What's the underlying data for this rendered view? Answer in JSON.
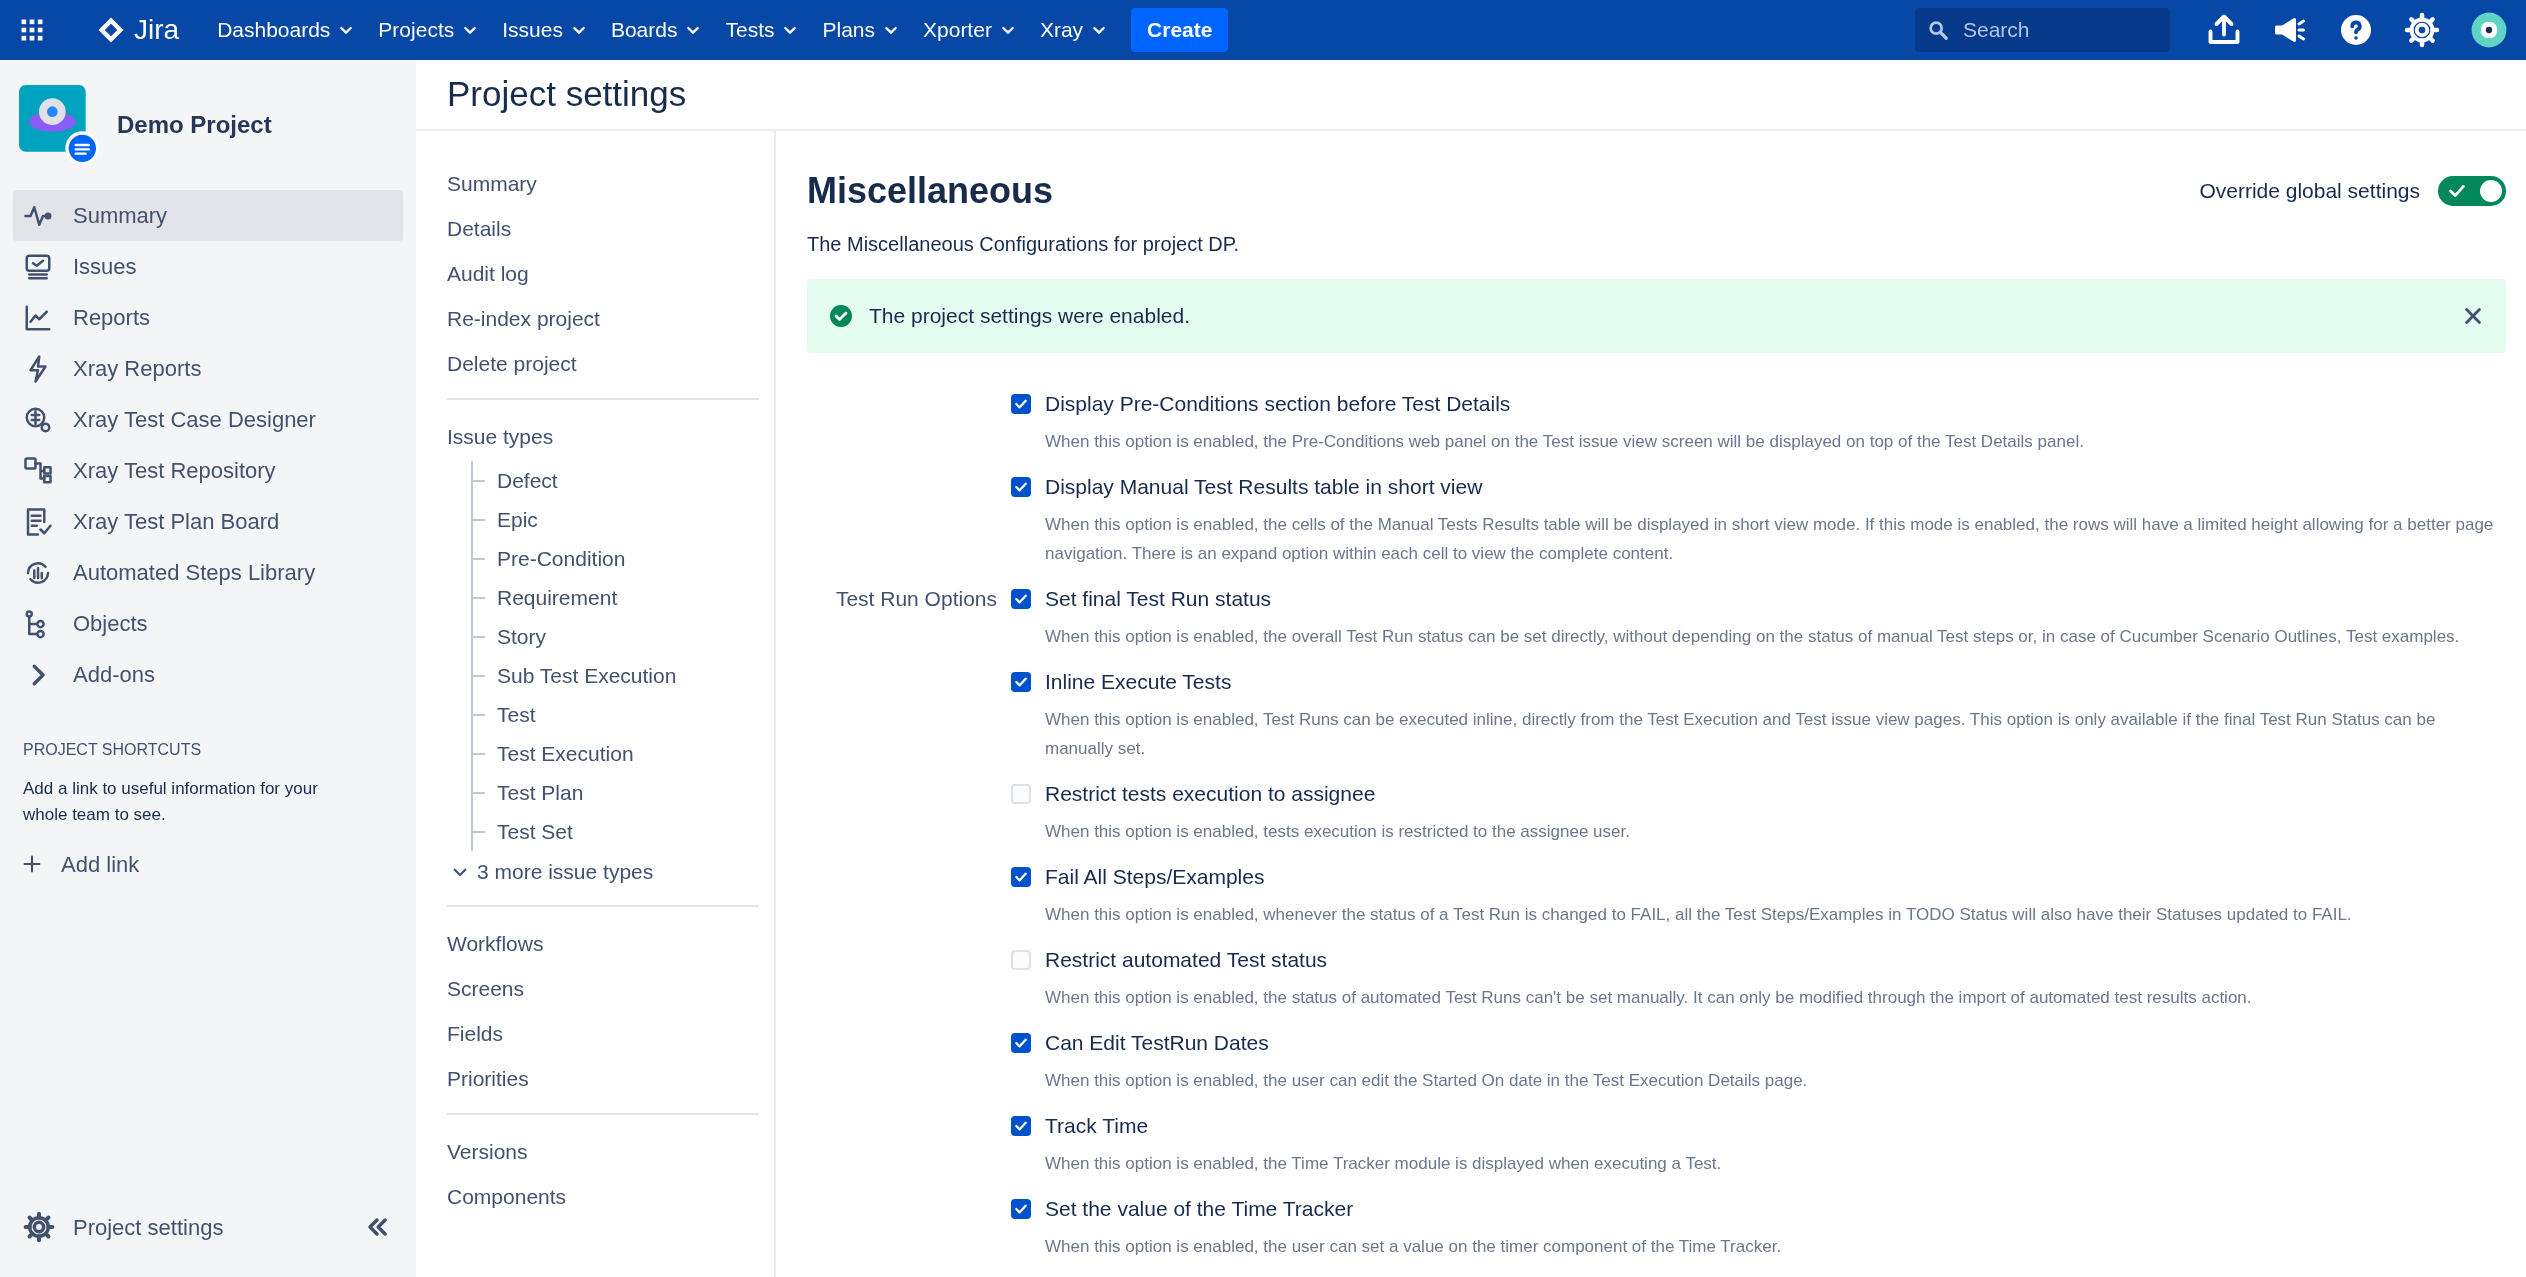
{
  "topbar": {
    "product": "Jira",
    "menus": [
      "Dashboards",
      "Projects",
      "Issues",
      "Boards",
      "Tests",
      "Plans",
      "Xporter",
      "Xray"
    ],
    "create": "Create",
    "search": {
      "placeholder": "Search"
    }
  },
  "sidebar": {
    "project": "Demo Project",
    "items": [
      {
        "label": "Summary",
        "selected": true
      },
      {
        "label": "Issues",
        "selected": false
      },
      {
        "label": "Reports",
        "selected": false
      },
      {
        "label": "Xray Reports",
        "selected": false
      },
      {
        "label": "Xray Test Case Designer",
        "selected": false
      },
      {
        "label": "Xray Test Repository",
        "selected": false
      },
      {
        "label": "Xray Test Plan Board",
        "selected": false
      },
      {
        "label": "Automated Steps Library",
        "selected": false
      },
      {
        "label": "Objects",
        "selected": false
      },
      {
        "label": "Add-ons",
        "selected": false
      }
    ],
    "shortcuts_heading": "PROJECT SHORTCUTS",
    "shortcuts_text": "Add a link to useful information for your whole team to see.",
    "add_link": "Add link",
    "footer": "Project settings"
  },
  "settings_nav": {
    "title": "Project settings",
    "sections": [
      {
        "items": [
          "Summary",
          "Details",
          "Audit log",
          "Re-index project",
          "Delete project"
        ]
      },
      {
        "heading": "Issue types",
        "children": [
          "Defect",
          "Epic",
          "Pre-Condition",
          "Requirement",
          "Story",
          "Sub Test Execution",
          "Test",
          "Test Execution",
          "Test Plan",
          "Test Set"
        ],
        "more": "3 more issue types"
      },
      {
        "items": [
          "Workflows",
          "Screens",
          "Fields",
          "Priorities"
        ]
      },
      {
        "items": [
          "Versions",
          "Components"
        ]
      }
    ]
  },
  "main": {
    "title": "Miscellaneous",
    "override": {
      "label": "Override global settings",
      "on": true
    },
    "subtitle": "The Miscellaneous Configurations for project DP.",
    "banner": "The project settings were enabled.",
    "groups": [
      {
        "options": [
          {
            "label": "Display Pre-Conditions section before Test Details",
            "checked": true,
            "description": "When this option is enabled, the Pre-Conditions web panel on the Test issue view screen will be displayed on top of the Test Details panel."
          },
          {
            "label": "Display Manual Test Results table in short view",
            "checked": true,
            "description": "When this option is enabled, the cells of the Manual Tests Results table will be displayed in short view mode. If this mode is enabled, the rows will have a limited height allowing for a better page navigation. There is an expand option within each cell to view the complete content."
          }
        ]
      },
      {
        "label": "Test Run Options",
        "options": [
          {
            "label": "Set final Test Run status",
            "checked": true,
            "description": "When this option is enabled, the overall Test Run status can be set directly, without depending on the status of manual Test steps or, in case of Cucumber Scenario Outlines, Test examples."
          },
          {
            "label": "Inline Execute Tests",
            "checked": true,
            "description": "When this option is enabled, Test Runs can be executed inline, directly from the Test Execution and Test issue view pages. This option is only available if the final Test Run Status can be manually set."
          },
          {
            "label": "Restrict tests execution to assignee",
            "checked": false,
            "description": "When this option is enabled, tests execution is restricted to the assignee user."
          },
          {
            "label": "Fail All Steps/Examples",
            "checked": true,
            "description": "When this option is enabled, whenever the status of a Test Run is changed to FAIL, all the Test Steps/Examples in TODO Status will also have their Statuses updated to FAIL."
          },
          {
            "label": "Restrict automated Test status",
            "checked": false,
            "description": "When this option is enabled, the status of automated Test Runs can't be set manually. It can only be modified through the import of automated test results action."
          },
          {
            "label": "Can Edit TestRun Dates",
            "checked": true,
            "description": "When this option is enabled, the user can edit the Started On date in the Test Execution Details page."
          },
          {
            "label": "Track Time",
            "checked": true,
            "description": "When this option is enabled, the Time Tracker module is displayed when executing a Test."
          },
          {
            "label": "Set the value of the Time Tracker",
            "checked": true,
            "description": "When this option is enabled, the user can set a value on the timer component of the Time Tracker."
          }
        ]
      }
    ]
  }
}
